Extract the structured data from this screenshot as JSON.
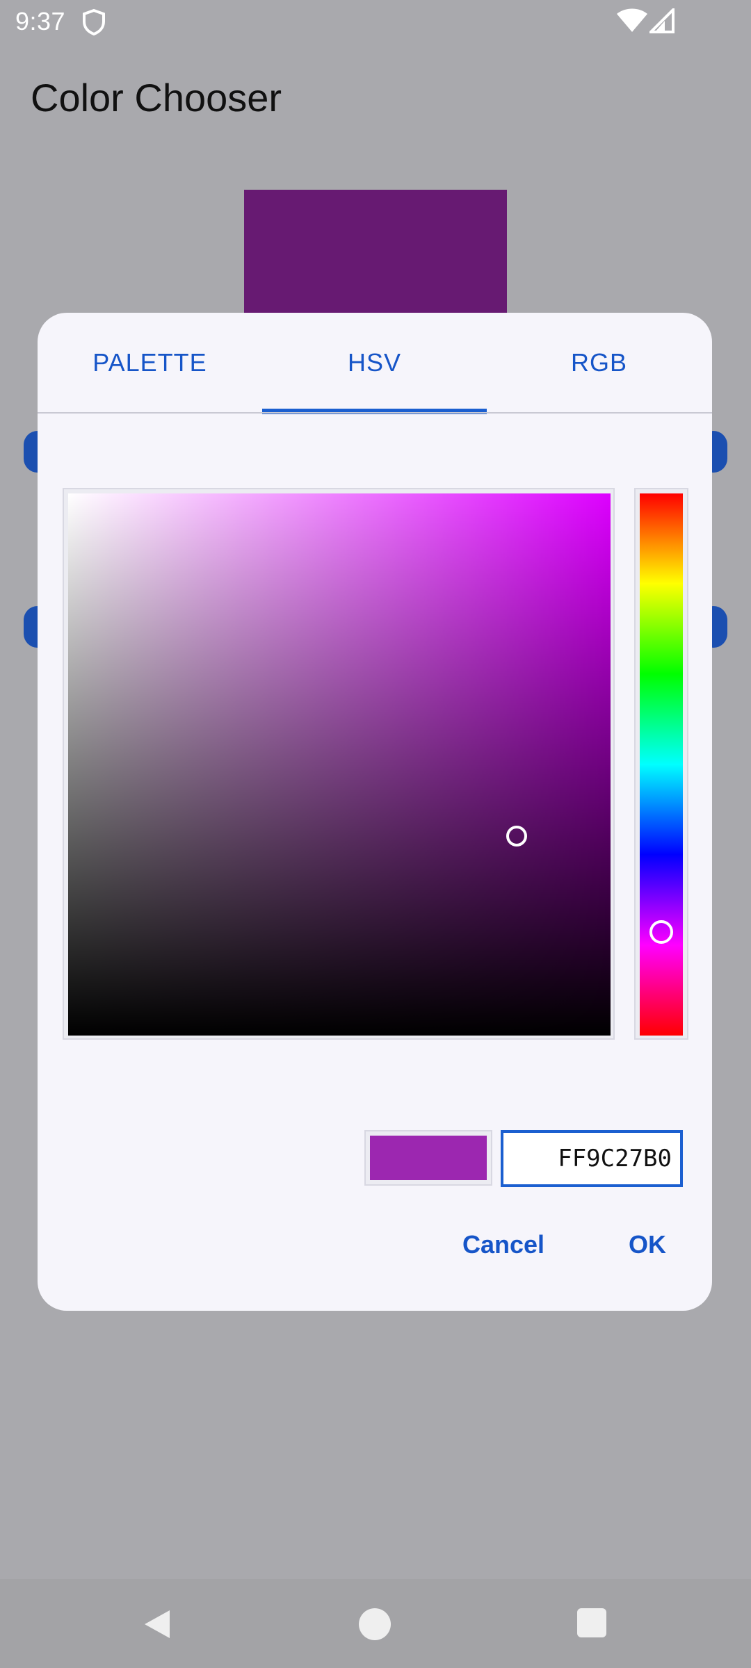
{
  "status_bar": {
    "time": "9:37",
    "icons": [
      "shield-icon",
      "wifi-icon",
      "cell-signal-icon"
    ]
  },
  "app": {
    "title": "Color Chooser",
    "preview_color": "#671A72"
  },
  "dialog": {
    "tabs": [
      {
        "label": "PALETTE",
        "selected": false
      },
      {
        "label": "HSV",
        "selected": true
      },
      {
        "label": "RGB",
        "selected": false
      }
    ],
    "hex_value": "FF9C27B0",
    "swatch_color": "#9C27B0",
    "cancel_label": "Cancel",
    "ok_label": "OK"
  },
  "colors": {
    "accent": "#1655C8",
    "dialog_bg": "#F6F5FB",
    "scrim": "#A9A9AD"
  },
  "nav_bar": {
    "icons": [
      "back-icon",
      "home-icon",
      "recents-icon"
    ]
  }
}
